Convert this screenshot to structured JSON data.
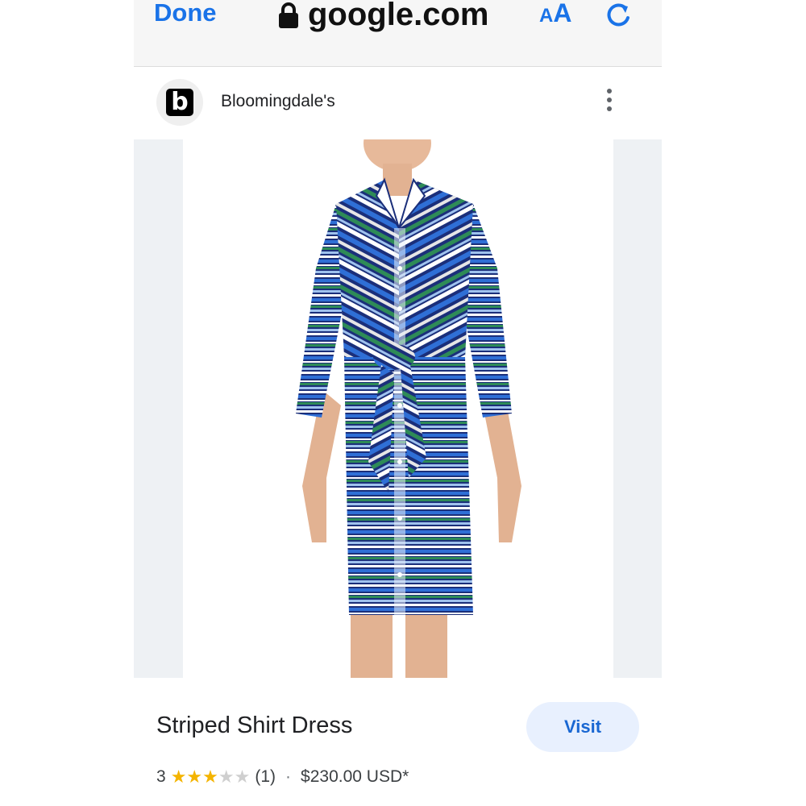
{
  "browser": {
    "done_label": "Done",
    "url": "google.com",
    "aa_small": "A",
    "aa_big": "A"
  },
  "source": {
    "logo_letter": "b",
    "name": "Bloomingdale's"
  },
  "product": {
    "title": "Striped Shirt Dress",
    "visit_label": "Visit",
    "rating": "3",
    "rating_value": 3,
    "rating_max": 5,
    "review_count": "(1)",
    "separator": "·",
    "price": "$230.00 USD*"
  },
  "colors": {
    "accent": "#1a73e8",
    "star": "#f4b400",
    "navy": "#1b2f7a",
    "blue": "#2f6fd6",
    "green": "#2e8b57"
  }
}
